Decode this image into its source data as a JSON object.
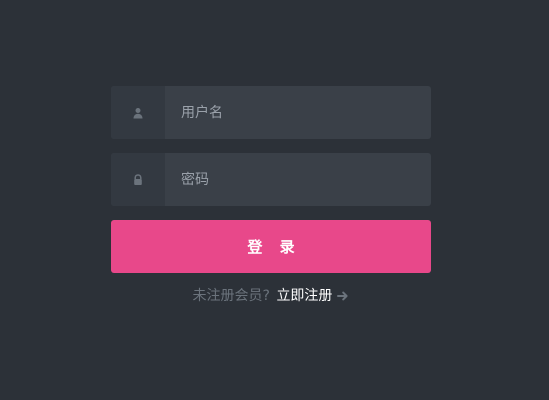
{
  "login": {
    "username_placeholder": "用户名",
    "username_value": "",
    "password_placeholder": "密码",
    "password_value": "",
    "submit_label": "登 录",
    "register_prompt": "未注册会员?",
    "register_link_label": "立即注册"
  },
  "icons": {
    "username": "user-icon",
    "password": "lock-icon",
    "register": "arrow-right-icon"
  },
  "colors": {
    "background": "#2c3138",
    "field_bg": "#3a4048",
    "icon_bg": "#333941",
    "primary": "#e8488a",
    "muted_text": "#6b737c"
  }
}
